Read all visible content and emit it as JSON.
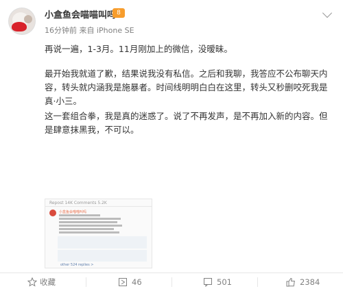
{
  "post": {
    "author": "小盒鱼会喵喵叫吗",
    "vip_badge": "8",
    "time": "16分钟前",
    "source": "来自 iPhone SE",
    "paragraphs": [
      "再说一遍，1-3月。11月刚加上的微信，没暧昧。",
      "最开始我就道了歉，结果说我没有私信。之后和我聊，我答应不公布聊天内容，转头就内涵我是施暴者。时间线明明白白在这里，转头又秒删咬死我是真·小三。",
      "这一套组合拳，我是真的迷惑了。说了不再发声，是不再加入新的内容。但是肆意抹黑我，不可以。"
    ]
  },
  "embed": {
    "header": "Repost 14K    Comments 5.2K",
    "author": "小盒鱼会喵喵叫吗",
    "more": "other 524 replies >"
  },
  "actions": {
    "favorite": "收藏",
    "repost": "46",
    "comment": "501",
    "like": "2384"
  }
}
